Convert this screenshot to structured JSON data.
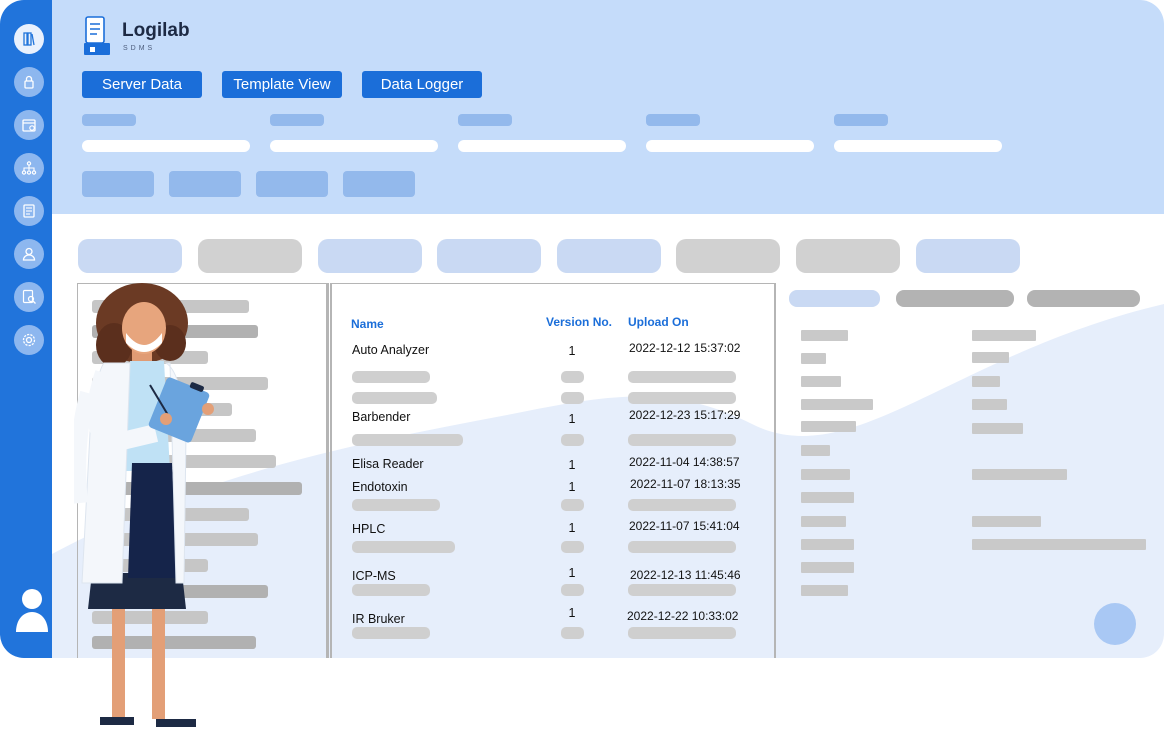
{
  "brand": {
    "name": "Logilab",
    "sub": "SDMS"
  },
  "nav_buttons": [
    {
      "label": "Server Data"
    },
    {
      "label": "Template View"
    },
    {
      "label": "Data Logger"
    }
  ],
  "sidebar_icons": [
    "library-icon",
    "lock-icon",
    "calendar-icon",
    "hierarchy-icon",
    "report-icon",
    "user-icon",
    "search-document-icon",
    "settings-icon"
  ],
  "table": {
    "headers": {
      "name": "Name",
      "version": "Version No.",
      "upload": "Upload On"
    },
    "rows": [
      {
        "name": "Auto Analyzer",
        "version": "1",
        "upload": "2022-12-12 15:37:02"
      },
      {
        "name": "Barbender",
        "version": "1",
        "upload": "2022-12-23 15:17:29"
      },
      {
        "name": "Elisa Reader",
        "version": "1",
        "upload": "2022-11-04 14:38:57"
      },
      {
        "name": "Endotoxin",
        "version": "1",
        "upload": "2022-11-07 18:13:35"
      },
      {
        "name": "HPLC",
        "version": "1",
        "upload": "2022-11-07 15:41:04"
      },
      {
        "name": "ICP-MS",
        "version": "1",
        "upload": "2022-12-13 11:45:46"
      },
      {
        "name": "IR Bruker",
        "version": "1",
        "upload": "2022-12-22 10:33:02"
      }
    ]
  },
  "colors": {
    "sidebar": "#2174db",
    "header_bg": "#c5dcfa",
    "accent": "#1b6ed9"
  }
}
